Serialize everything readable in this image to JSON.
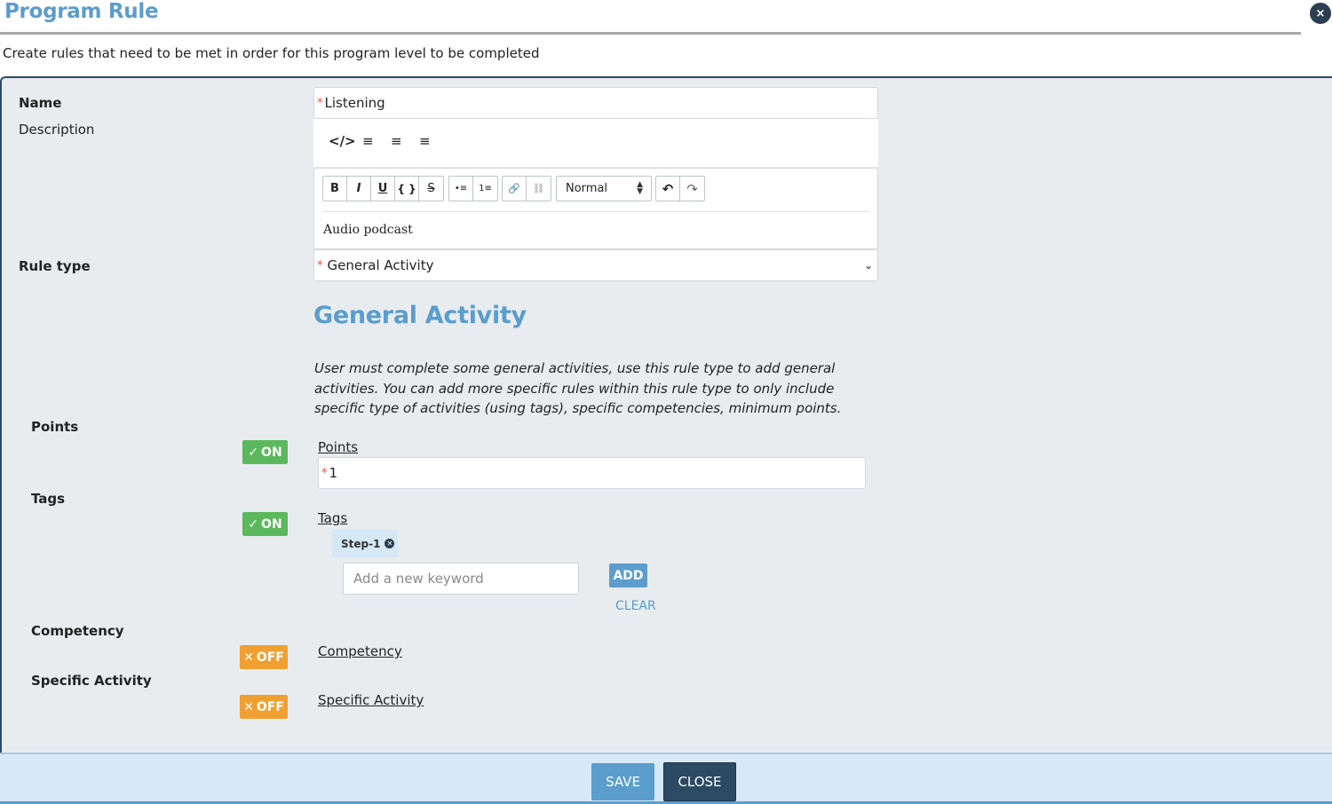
{
  "dialog": {
    "title": "Program Rule",
    "close_glyph": "×",
    "subtitle": "Create rules that need to be met in order for this program level to be completed"
  },
  "form": {
    "name_label": "Name",
    "name_value": "Listening",
    "required_mark": "*",
    "description_label": "Description",
    "editor": {
      "mode_icons": [
        "</>",
        "≡",
        "≡",
        "≡"
      ],
      "toolbar_format": [
        "B",
        "I",
        "U",
        "{ }",
        "S"
      ],
      "toolbar_lists": [
        "•≡",
        "1≡"
      ],
      "toolbar_links": [
        "🔗",
        "⛓"
      ],
      "header_select": "Normal",
      "toolbar_history": [
        "↶",
        "↷"
      ],
      "content": "Audio podcast"
    },
    "rule_type_label": "Rule type",
    "rule_type_value": "General Activity"
  },
  "section": {
    "title": "General Activity",
    "description": "User must complete some general activities, use this rule type to add general activities. You can add more specific rules within this rule type to only include specific type of activities (using tags), specific competencies, minimum points."
  },
  "rules": {
    "points": {
      "label": "Points",
      "toggle": "ON",
      "field_label": "Points",
      "value": "1"
    },
    "tags": {
      "label": "Tags",
      "toggle": "ON",
      "field_label": "Tags",
      "chips": [
        "Step-1"
      ],
      "keyword_placeholder": "Add a new keyword",
      "add_label": "ADD",
      "clear_label": "CLEAR"
    },
    "competency": {
      "label": "Competency",
      "toggle": "OFF",
      "field_label": "Competency"
    },
    "specific_activity": {
      "label": "Specific Activity",
      "toggle": "OFF",
      "field_label": "Specific Activity"
    }
  },
  "footer": {
    "save_label": "SAVE",
    "close_label": "CLOSE"
  },
  "colors": {
    "accent": "#5b9dcc",
    "on": "#5cb85c",
    "off": "#f0a030",
    "dark": "#2c4a62"
  }
}
